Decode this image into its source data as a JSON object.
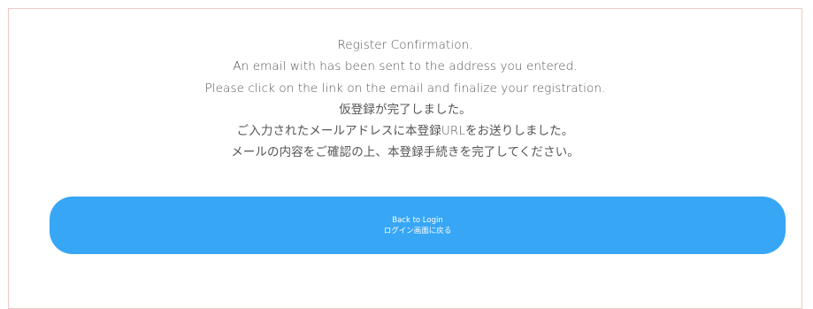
{
  "confirmation": {
    "title": "Register Confirmation.",
    "line_en_1": "An email with has been sent to the address you entered.",
    "line_en_2": "Please click on the link on the email and finalize your registration.",
    "line_ja_1": "仮登録が完了しました。",
    "line_ja_2": "ご入力されたメールアドレスに本登録URLをお送りしました。",
    "line_ja_3": "メールの内容をご確認の上、本登録手続きを完了してください。"
  },
  "button": {
    "label_en": "Back to Login",
    "label_ja": "ログイン画面に戻る"
  },
  "colors": {
    "accent": "#37a6f5",
    "border": "#f0c9c4",
    "text": "#555555"
  }
}
